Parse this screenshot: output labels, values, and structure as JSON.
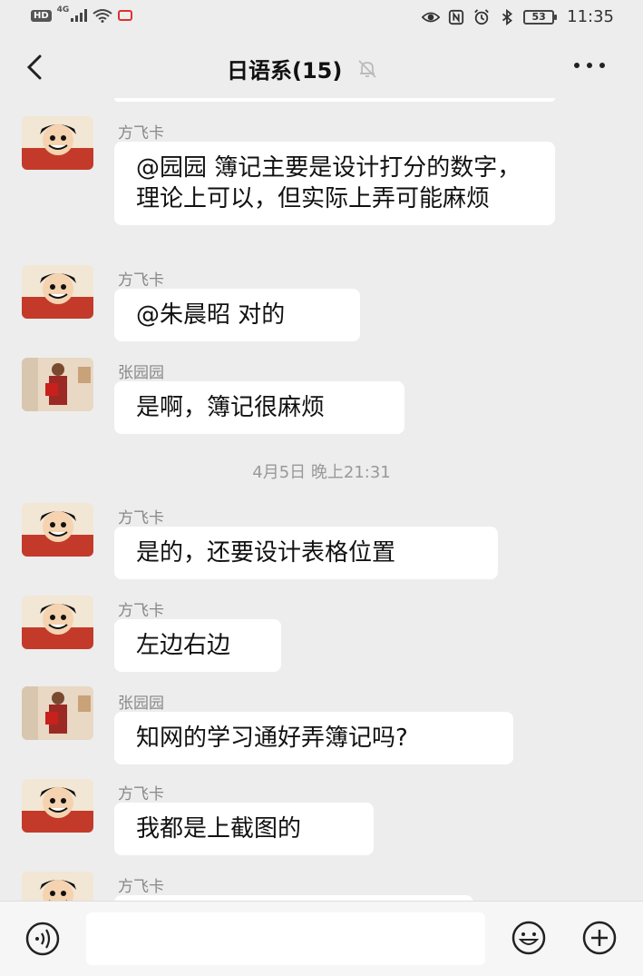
{
  "status_bar": {
    "hd": "HD",
    "network": "4G",
    "battery": "53",
    "time": "11:35"
  },
  "header": {
    "title": "日语系(15)"
  },
  "messages": [
    {
      "sender": "方飞卡",
      "text": "@园园  簿记主要是设计打分的数字，理论上可以，但实际上弄可能麻烦",
      "avatar": "luffy"
    },
    {
      "sender": "方飞卡",
      "text": "@朱晨昭  对的",
      "avatar": "luffy"
    },
    {
      "sender": "张园园",
      "text": "是啊，簿记很麻烦",
      "avatar": "photo"
    },
    {
      "sender": "方飞卡",
      "text": "是的，还要设计表格位置",
      "avatar": "luffy"
    },
    {
      "sender": "方飞卡",
      "text": "左边右边",
      "avatar": "luffy"
    },
    {
      "sender": "张园园",
      "text": "知网的学习通好弄簿记吗?",
      "avatar": "photo"
    },
    {
      "sender": "方飞卡",
      "text": "我都是上截图的",
      "avatar": "luffy"
    },
    {
      "sender": "方飞卡",
      "text": "",
      "avatar": "luffy"
    }
  ],
  "timestamp": "4月5日 晚上21:31",
  "input": {
    "placeholder": ""
  },
  "icons": {
    "back": "back-chevron-icon",
    "mute": "muted-bell-icon",
    "more": "more-dots-icon",
    "voice": "voice-icon",
    "emoji": "emoji-icon",
    "plus": "plus-icon"
  }
}
